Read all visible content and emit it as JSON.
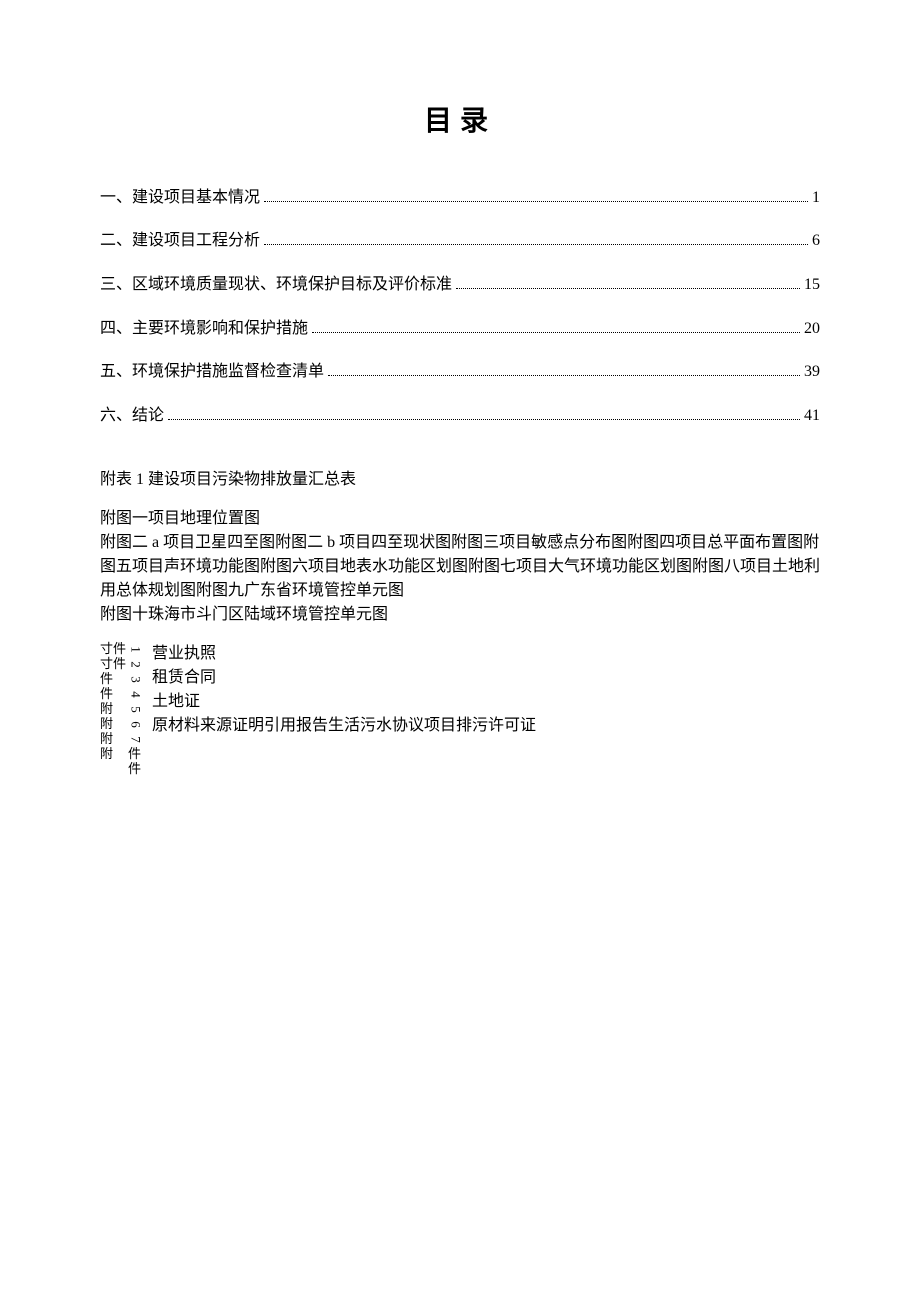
{
  "title": "目录",
  "toc": [
    {
      "label": "一、建设项目基本情况",
      "page": "1"
    },
    {
      "label": "二、建设项目工程分析",
      "page": "6"
    },
    {
      "label": "三、区域环境质量现状、环境保护目标及评价标准",
      "page": "15"
    },
    {
      "label": "四、主要环境影响和保护措施",
      "page": "20"
    },
    {
      "label": "五、环境保护措施监督检查清单",
      "page": "39"
    },
    {
      "label": "六、结论",
      "page": "41"
    }
  ],
  "appendix_table": "附表 1 建设项目污染物排放量汇总表",
  "appendix_figures_line1": "附图一项目地理位置图",
  "appendix_figures_line2": "附图二 a 项目卫星四至图附图二 b 项目四至现状图附图三项目敏感点分布图附图四项目总平面布置图附图五项目声环境功能图附图六项目地表水功能区划图附图七项目大气环境功能区划图附图八项目土地利用总体规划图附图九广东省环境管控单元图",
  "appendix_figures_line3": "附图十珠海市斗门区陆域环境管控单元图",
  "attachments_labels": {
    "c1": [
      "寸件",
      "寸件",
      "件",
      "件",
      "附",
      "附",
      "附",
      "附"
    ],
    "c2": [
      "1",
      "2",
      "3",
      "4",
      "5",
      "6",
      "7",
      "件",
      "件"
    ]
  },
  "attachments_content": [
    "营业执照",
    "租赁合同",
    "土地证",
    "原材料来源证明引用报告生活污水协议项目排污许可证"
  ]
}
